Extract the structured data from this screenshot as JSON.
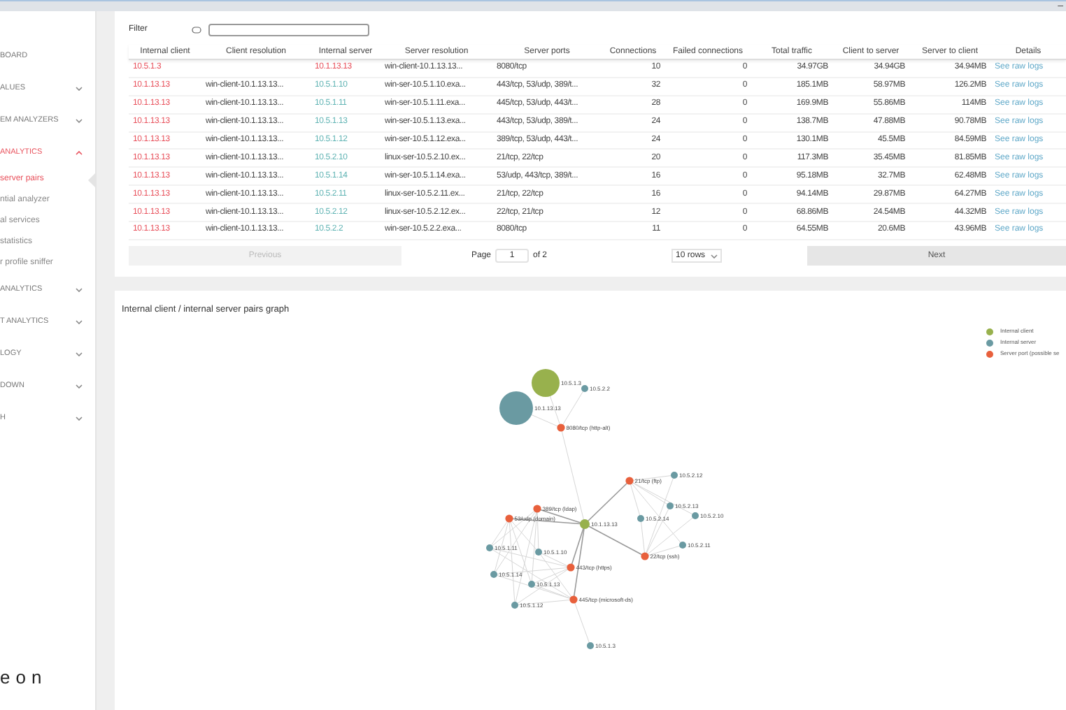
{
  "window": {
    "control": "–"
  },
  "sidebar": {
    "items": [
      {
        "label": "BOARD",
        "kind": "section",
        "selected": false
      },
      {
        "label": "ALUES",
        "kind": "section",
        "expanded": false,
        "selected": false
      },
      {
        "label": "EM ANALYZERS",
        "kind": "section",
        "expanded": false,
        "selected": false
      },
      {
        "label": "ANALYTICS",
        "kind": "section",
        "expanded": true,
        "selected": true
      },
      {
        "label": "server pairs",
        "kind": "sub",
        "selected": true
      },
      {
        "label": "ntial analyzer",
        "kind": "sub",
        "selected": false
      },
      {
        "label": "al services",
        "kind": "sub",
        "selected": false
      },
      {
        "label": "statistics",
        "kind": "sub",
        "selected": false
      },
      {
        "label": "r profile sniffer",
        "kind": "sub",
        "selected": false
      },
      {
        "label": "ANALYTICS",
        "kind": "section",
        "expanded": false,
        "selected": false
      },
      {
        "label": "T ANALYTICS",
        "kind": "section",
        "expanded": false,
        "selected": false
      },
      {
        "label": "LOGY",
        "kind": "section",
        "expanded": false,
        "selected": false
      },
      {
        "label": "DOWN",
        "kind": "section",
        "expanded": false,
        "selected": false
      },
      {
        "label": "H",
        "kind": "section",
        "expanded": false,
        "selected": false
      }
    ],
    "logo": "eon"
  },
  "table": {
    "filter_label": "Filter",
    "columns": [
      "Internal client",
      "Client resolution",
      "Internal server",
      "Server resolution",
      "Server ports",
      "Connections",
      "Failed connections",
      "Total traffic",
      "Client to server",
      "Server to client",
      "Details"
    ],
    "rows": [
      {
        "client": "10.5.1.3",
        "client_resolution": "",
        "server": "10.1.13.13",
        "server_highlighted": true,
        "server_resolution": "win-client-10.1.13.13...",
        "ports": "8080/tcp",
        "connections": "10",
        "failed": "0",
        "total": "34.97GB",
        "c2s": "34.94GB",
        "s2c": "34.94MB",
        "details": "See raw logs"
      },
      {
        "client": "10.1.13.13",
        "client_resolution": "win-client-10.1.13.13...",
        "server": "10.5.1.10",
        "server_highlighted": false,
        "server_resolution": "win-ser-10.5.1.10.exa...",
        "ports": "443/tcp, 53/udp, 389/t...",
        "connections": "32",
        "failed": "0",
        "total": "185.1MB",
        "c2s": "58.97MB",
        "s2c": "126.2MB",
        "details": "See raw logs"
      },
      {
        "client": "10.1.13.13",
        "client_resolution": "win-client-10.1.13.13...",
        "server": "10.5.1.11",
        "server_highlighted": false,
        "server_resolution": "win-ser-10.5.1.11.exa...",
        "ports": "445/tcp, 53/udp, 443/t...",
        "connections": "28",
        "failed": "0",
        "total": "169.9MB",
        "c2s": "55.86MB",
        "s2c": "114MB",
        "details": "See raw logs"
      },
      {
        "client": "10.1.13.13",
        "client_resolution": "win-client-10.1.13.13...",
        "server": "10.5.1.13",
        "server_highlighted": false,
        "server_resolution": "win-ser-10.5.1.13.exa...",
        "ports": "443/tcp, 53/udp, 389/t...",
        "connections": "24",
        "failed": "0",
        "total": "138.7MB",
        "c2s": "47.88MB",
        "s2c": "90.78MB",
        "details": "See raw logs"
      },
      {
        "client": "10.1.13.13",
        "client_resolution": "win-client-10.1.13.13...",
        "server": "10.5.1.12",
        "server_highlighted": false,
        "server_resolution": "win-ser-10.5.1.12.exa...",
        "ports": "389/tcp, 53/udp, 443/t...",
        "connections": "24",
        "failed": "0",
        "total": "130.1MB",
        "c2s": "45.5MB",
        "s2c": "84.59MB",
        "details": "See raw logs"
      },
      {
        "client": "10.1.13.13",
        "client_resolution": "win-client-10.1.13.13...",
        "server": "10.5.2.10",
        "server_highlighted": false,
        "server_resolution": "linux-ser-10.5.2.10.ex...",
        "ports": "21/tcp, 22/tcp",
        "connections": "20",
        "failed": "0",
        "total": "117.3MB",
        "c2s": "35.45MB",
        "s2c": "81.85MB",
        "details": "See raw logs"
      },
      {
        "client": "10.1.13.13",
        "client_resolution": "win-client-10.1.13.13...",
        "server": "10.5.1.14",
        "server_highlighted": false,
        "server_resolution": "win-ser-10.5.1.14.exa...",
        "ports": "53/udp, 443/tcp, 389/t...",
        "connections": "16",
        "failed": "0",
        "total": "95.18MB",
        "c2s": "32.7MB",
        "s2c": "62.48MB",
        "details": "See raw logs"
      },
      {
        "client": "10.1.13.13",
        "client_resolution": "win-client-10.1.13.13...",
        "server": "10.5.2.11",
        "server_highlighted": false,
        "server_resolution": "linux-ser-10.5.2.11.ex...",
        "ports": "21/tcp, 22/tcp",
        "connections": "16",
        "failed": "0",
        "total": "94.14MB",
        "c2s": "29.87MB",
        "s2c": "64.27MB",
        "details": "See raw logs"
      },
      {
        "client": "10.1.13.13",
        "client_resolution": "win-client-10.1.13.13...",
        "server": "10.5.2.12",
        "server_highlighted": false,
        "server_resolution": "linux-ser-10.5.2.12.ex...",
        "ports": "22/tcp, 21/tcp",
        "connections": "12",
        "failed": "0",
        "total": "68.86MB",
        "c2s": "24.54MB",
        "s2c": "44.32MB",
        "details": "See raw logs"
      },
      {
        "client": "10.1.13.13",
        "client_resolution": "win-client-10.1.13.13...",
        "server": "10.5.2.2",
        "server_highlighted": false,
        "server_resolution": "win-ser-10.5.2.2.exa...",
        "ports": "8080/tcp",
        "connections": "11",
        "failed": "0",
        "total": "64.55MB",
        "c2s": "20.6MB",
        "s2c": "43.96MB",
        "details": "See raw logs"
      }
    ],
    "pagination": {
      "previous": "Previous",
      "previous_disabled": true,
      "page_label": "Page",
      "page": "1",
      "of": "of 2",
      "rows": "10 rows",
      "next": "Next"
    }
  },
  "graph": {
    "title": "Internal client / internal server pairs graph",
    "legend": [
      {
        "kind": "client",
        "label": "Internal client",
        "color": "#98b14d"
      },
      {
        "kind": "server",
        "label": "Internal server",
        "color": "#6a9aa2"
      },
      {
        "kind": "port",
        "label": "Server port (possible se",
        "color": "#e8603c"
      }
    ],
    "nodes": [
      {
        "label": "10.5.1.3",
        "kind": "client"
      },
      {
        "label": "10.1.13.13",
        "kind": "server"
      },
      {
        "label": "10.5.2.2",
        "kind": "server"
      },
      {
        "label": "8080/tcp (http-alt)",
        "kind": "port"
      },
      {
        "label": "10.1.13.13",
        "kind": "client"
      },
      {
        "label": "21/tcp (ftp)",
        "kind": "port"
      },
      {
        "label": "10.5.2.12",
        "kind": "server"
      },
      {
        "label": "10.5.2.13",
        "kind": "server"
      },
      {
        "label": "10.5.2.10",
        "kind": "server"
      },
      {
        "label": "10.5.2.14",
        "kind": "server"
      },
      {
        "label": "10.5.2.11",
        "kind": "server"
      },
      {
        "label": "22/tcp (ssh)",
        "kind": "port"
      },
      {
        "label": "389/tcp (ldap)",
        "kind": "port"
      },
      {
        "label": "53/udp (domain)",
        "kind": "port"
      },
      {
        "label": "10.5.1.11",
        "kind": "server"
      },
      {
        "label": "10.5.1.10",
        "kind": "server"
      },
      {
        "label": "10.5.1.14",
        "kind": "server"
      },
      {
        "label": "443/tcp (https)",
        "kind": "port"
      },
      {
        "label": "10.5.1.13",
        "kind": "server"
      },
      {
        "label": "10.5.1.12",
        "kind": "server"
      },
      {
        "label": "445/tcp (microsoft-ds)",
        "kind": "port"
      },
      {
        "label": "10.5.1.3",
        "kind": "server"
      }
    ]
  }
}
